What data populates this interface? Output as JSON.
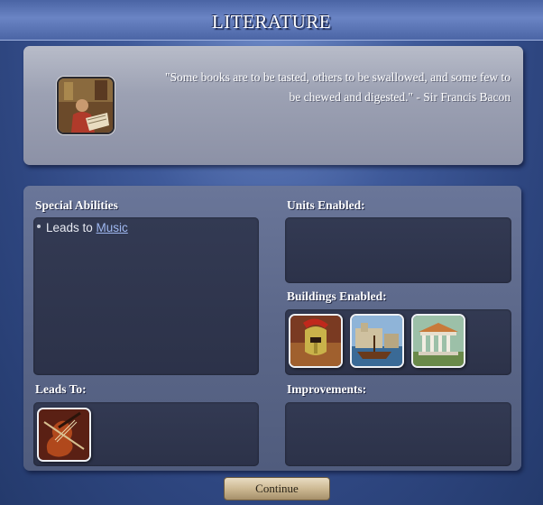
{
  "window": {
    "title": "LITERATURE"
  },
  "header": {
    "tech_icon": "literature-scholar-icon",
    "quote": "\"Some books are to be tasted, others to be swallowed, and some few to be chewed and digested.\" - Sir Francis Bacon"
  },
  "sections": {
    "special_abilities": {
      "label": "Special Abilities",
      "items": [
        {
          "prefix": "Leads to ",
          "link": "Music"
        }
      ]
    },
    "units_enabled": {
      "label": "Units Enabled:"
    },
    "buildings_enabled": {
      "label": "Buildings Enabled:",
      "items": [
        {
          "icon": "gladiator-helmet-icon"
        },
        {
          "icon": "harbor-ship-icon"
        },
        {
          "icon": "temple-building-icon"
        }
      ]
    },
    "leads_to": {
      "label": "Leads To:",
      "items": [
        {
          "icon": "violin-music-icon"
        }
      ]
    },
    "improvements": {
      "label": "Improvements:"
    }
  },
  "buttons": {
    "continue": "Continue"
  },
  "colors": {
    "background": "#2e4680",
    "panel_light": "#9ca1b3",
    "panel_main": "#5b6789",
    "inner_box": "#2f3650",
    "link": "#9fb8f0",
    "button": "#cdb993"
  }
}
